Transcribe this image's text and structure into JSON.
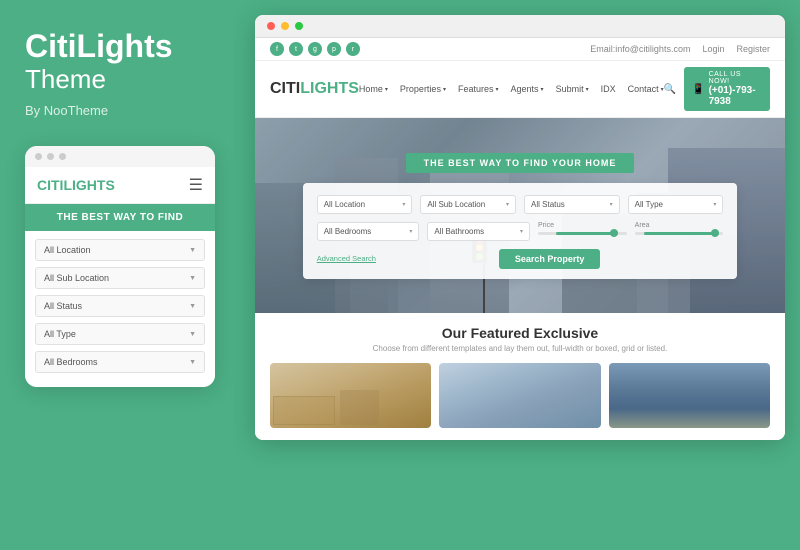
{
  "brand": {
    "name": "CitiLights",
    "sub": "Theme",
    "by": "By NooTheme"
  },
  "mobile": {
    "logo_citi": "CITI",
    "logo_lights": "LIGHTS",
    "hero_text": "THE BEST WAY TO FIND",
    "dropdown_1": "All Location",
    "dropdown_2": "All Sub Location",
    "dropdown_3": "All Status",
    "dropdown_4": "All Type",
    "dropdown_5": "All Bedrooms"
  },
  "browser": {
    "topbar": {
      "email": "Email:info@citilights.com",
      "login": "Login",
      "register": "Register"
    },
    "navbar": {
      "logo_citi": "CITI",
      "logo_lights": "LIGHTS",
      "links": [
        "Home",
        "Properties",
        "Features",
        "Agents",
        "Submit",
        "IDX",
        "Contact"
      ],
      "call_label": "CALL US NOW!",
      "phone": "(+01)-793-7938"
    },
    "hero": {
      "badge": "THE BEST WAY TO FIND YOUR HOME",
      "search": {
        "location": "All Location",
        "sub_location": "All Sub Location",
        "status": "All Status",
        "type": "All Type",
        "bedrooms": "All Bedrooms",
        "bathrooms": "All Bathrooms",
        "price_label": "Price",
        "area_label": "Area",
        "advanced": "Advanced Search",
        "button": "Search Property"
      }
    },
    "featured": {
      "title": "Our Featured Exclusive",
      "subtitle": "Choose from different templates and lay them out, full-width or boxed, grid or listed."
    }
  },
  "colors": {
    "accent": "#4caf85"
  }
}
